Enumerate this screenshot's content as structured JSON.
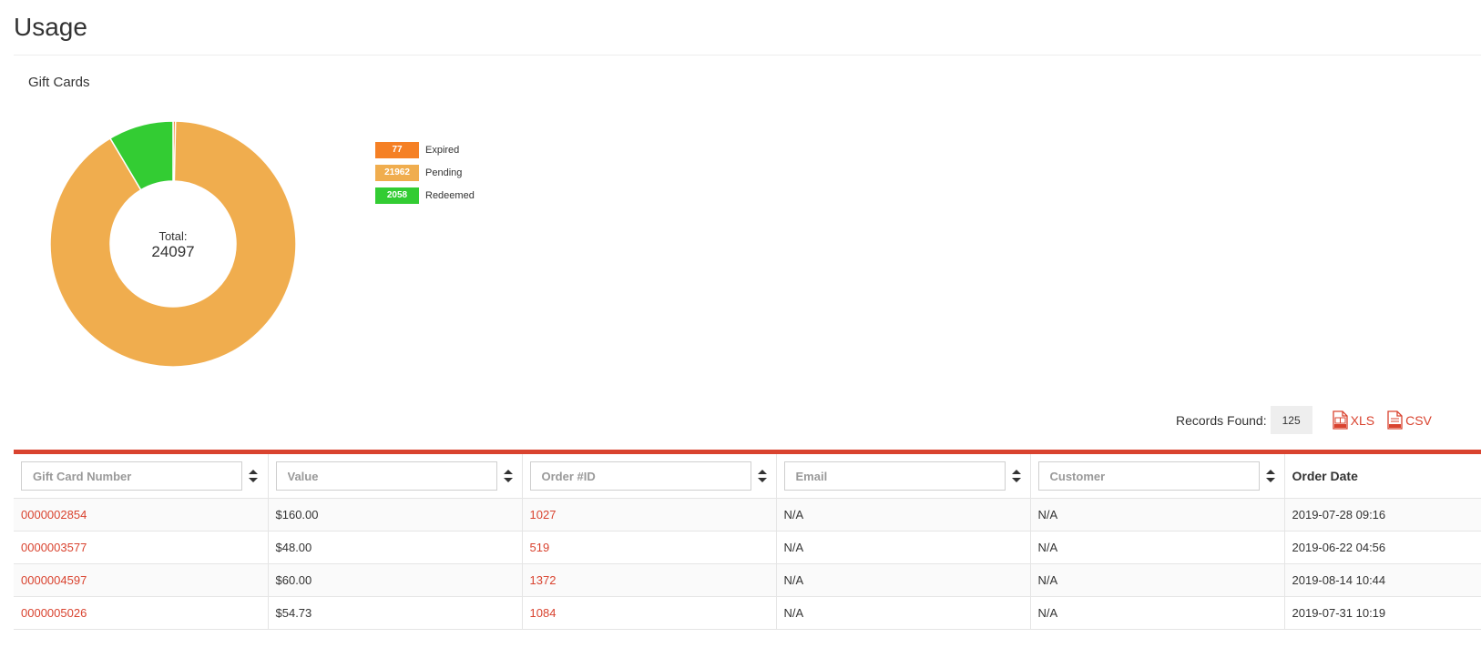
{
  "page": {
    "title": "Usage"
  },
  "section": {
    "title": "Gift Cards"
  },
  "chart_data": {
    "type": "pie",
    "variant": "donut",
    "center_label": "Total:",
    "total": "24097",
    "series": [
      {
        "name": "Expired",
        "value": 77,
        "label": "77",
        "color": "#f58025"
      },
      {
        "name": "Pending",
        "value": 21962,
        "label": "21962",
        "color": "#f0ad4e"
      },
      {
        "name": "Redeemed",
        "value": 2058,
        "label": "2058",
        "color": "#33cc33"
      }
    ],
    "legend_position": "right"
  },
  "records": {
    "label": "Records Found:",
    "count": "125",
    "xls_label": "XLS",
    "csv_label": "CSV"
  },
  "table": {
    "filters": [
      {
        "placeholder": "Gift Card Number"
      },
      {
        "placeholder": "Value"
      },
      {
        "placeholder": "Order #ID"
      },
      {
        "placeholder": "Email"
      },
      {
        "placeholder": "Customer"
      }
    ],
    "last_header": "Order Date",
    "rows": [
      {
        "card": "0000002854",
        "value": "$160.00",
        "order": "1027",
        "email": "N/A",
        "customer": "N/A",
        "date": "2019-07-28 09:16"
      },
      {
        "card": "0000003577",
        "value": "$48.00",
        "order": "519",
        "email": "N/A",
        "customer": "N/A",
        "date": "2019-06-22 04:56"
      },
      {
        "card": "0000004597",
        "value": "$60.00",
        "order": "1372",
        "email": "N/A",
        "customer": "N/A",
        "date": "2019-08-14 10:44"
      },
      {
        "card": "0000005026",
        "value": "$54.73",
        "order": "1084",
        "email": "N/A",
        "customer": "N/A",
        "date": "2019-07-31 10:19"
      }
    ]
  },
  "colors": {
    "accent": "#d9432f"
  },
  "icons": {
    "sort": "sort-arrows-icon",
    "xls": "xls-file-icon",
    "csv": "csv-file-icon"
  }
}
